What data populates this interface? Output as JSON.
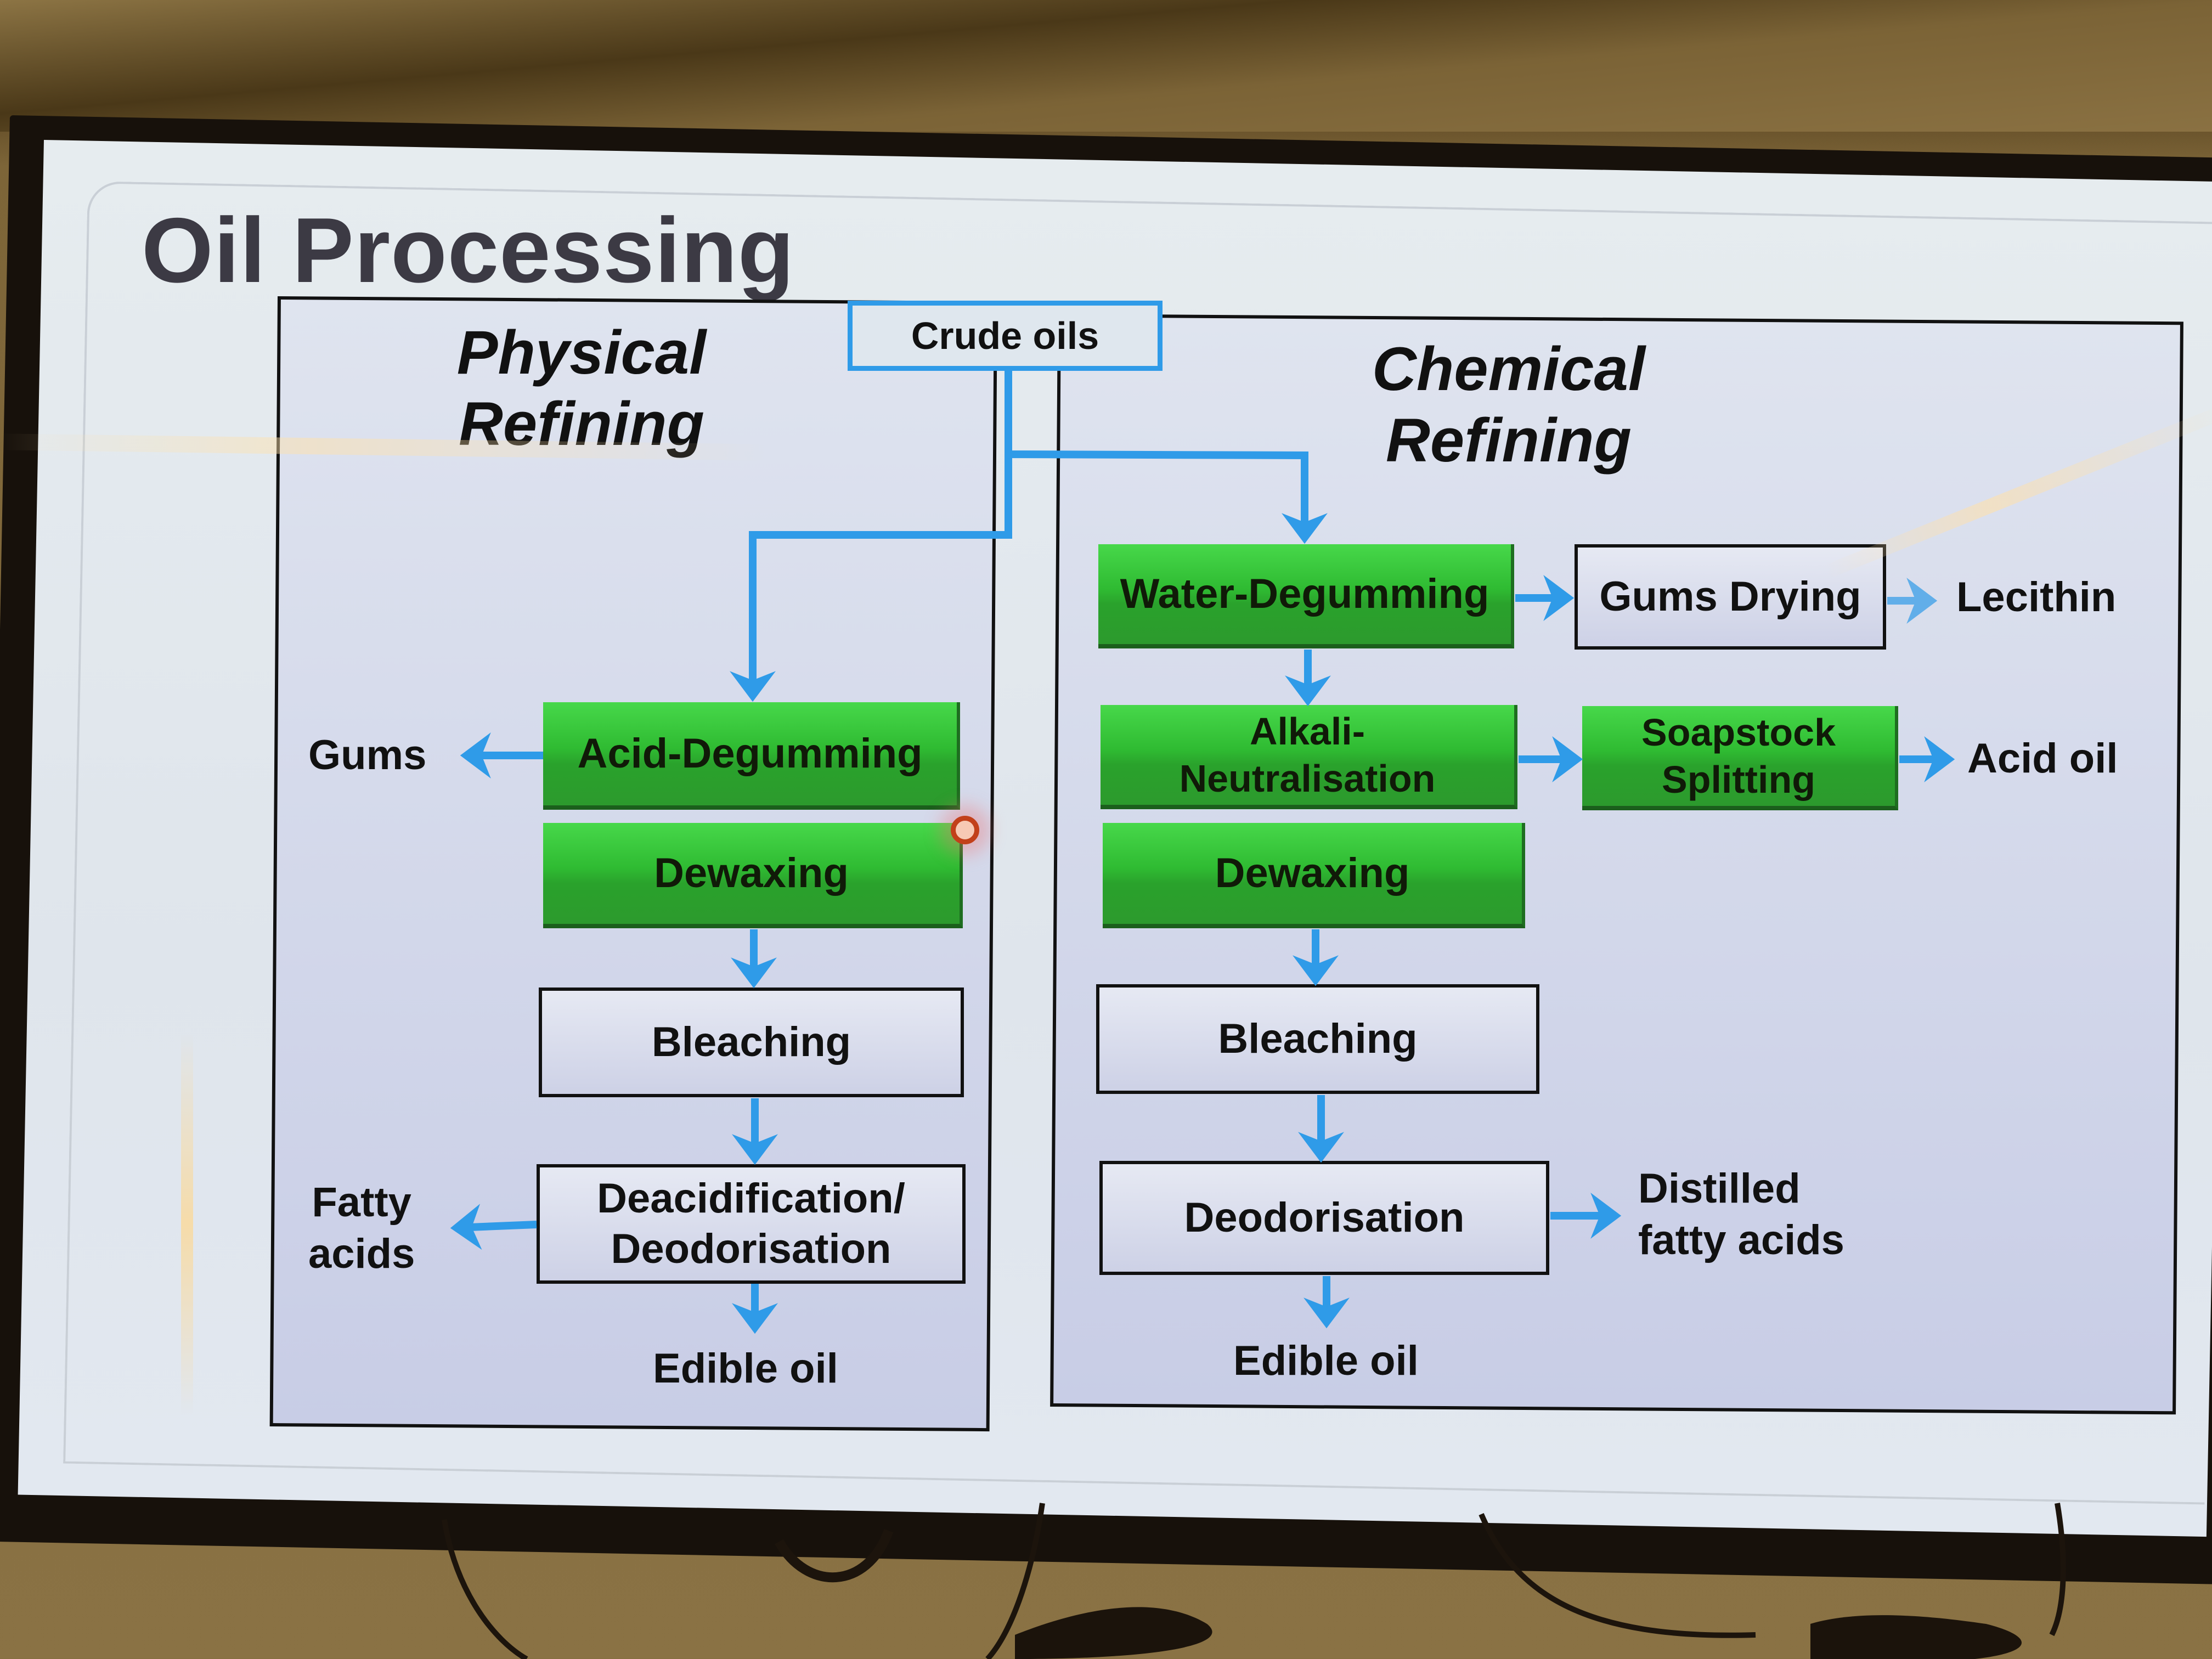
{
  "slide": {
    "title": "Oil Processing",
    "source_node": "Crude oils",
    "colors": {
      "process_green": "#2fbb32",
      "arrow_blue": "#2f9be8",
      "panel_bg": "#cdd1e6",
      "title_text": "#3c3a44",
      "laser_pointer": "#c2401a"
    }
  },
  "physical": {
    "title_line1": "Physical",
    "title_line2": "Refining",
    "steps": [
      {
        "label": "Acid-Degumming",
        "style": "green",
        "byproduct": "Gums"
      },
      {
        "label": "Dewaxing",
        "style": "green"
      },
      {
        "label": "Bleaching",
        "style": "white"
      },
      {
        "label_line1": "Deacidification/",
        "label_line2": "Deodorisation",
        "style": "white",
        "byproduct_line1": "Fatty",
        "byproduct_line2": "acids"
      }
    ],
    "output": "Edible oil"
  },
  "chemical": {
    "title_line1": "Chemical",
    "title_line2": "Refining",
    "steps": [
      {
        "label": "Water-Degumming",
        "style": "green",
        "side_step": "Gums Drying",
        "side_output": "Lecithin"
      },
      {
        "label_line1": "Alkali-",
        "label_line2": "Neutralisation",
        "style": "green",
        "side_step_line1": "Soapstock",
        "side_step_line2": "Splitting",
        "side_output": "Acid oil"
      },
      {
        "label": "Dewaxing",
        "style": "green"
      },
      {
        "label": "Bleaching",
        "style": "white"
      },
      {
        "label": "Deodorisation",
        "style": "white",
        "byproduct_line1": "Distilled",
        "byproduct_line2": "fatty acids"
      }
    ],
    "output": "Edible oil"
  },
  "icons": {
    "arrow": "arrow-icon",
    "laser": "laser-pointer-dot"
  }
}
